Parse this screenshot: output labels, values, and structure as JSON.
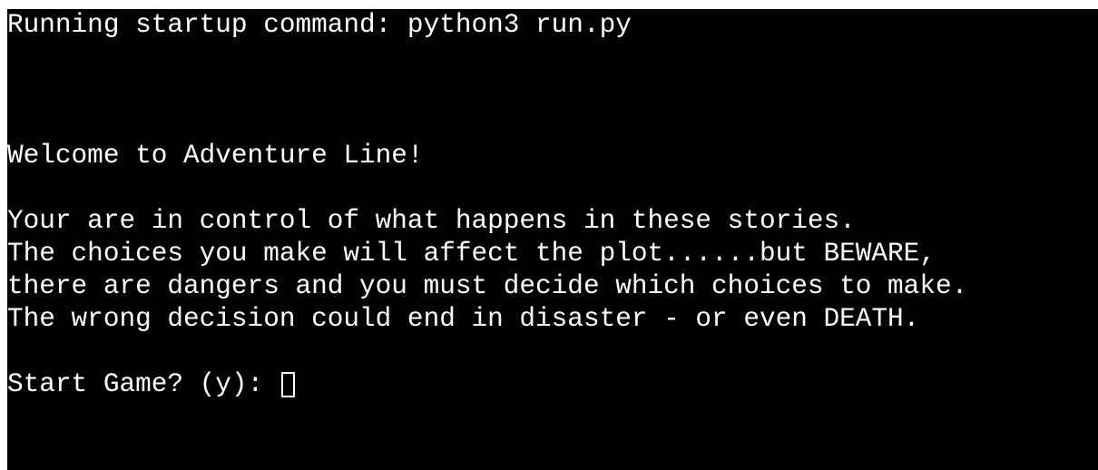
{
  "terminal": {
    "startup_line": "Running startup command: python3 run.py",
    "welcome_line": "Welcome to Adventure Line!",
    "intro_lines": [
      "Your are in control of what happens in these stories.",
      "The choices you make will affect the plot......but BEWARE,",
      "there are dangers and you must decide which choices to make.",
      "The wrong decision could end in disaster - or even DEATH."
    ],
    "prompt_label": "Start Game? (y): ",
    "input_value": ""
  },
  "colors": {
    "background": "#000000",
    "text": "#ffffff"
  }
}
